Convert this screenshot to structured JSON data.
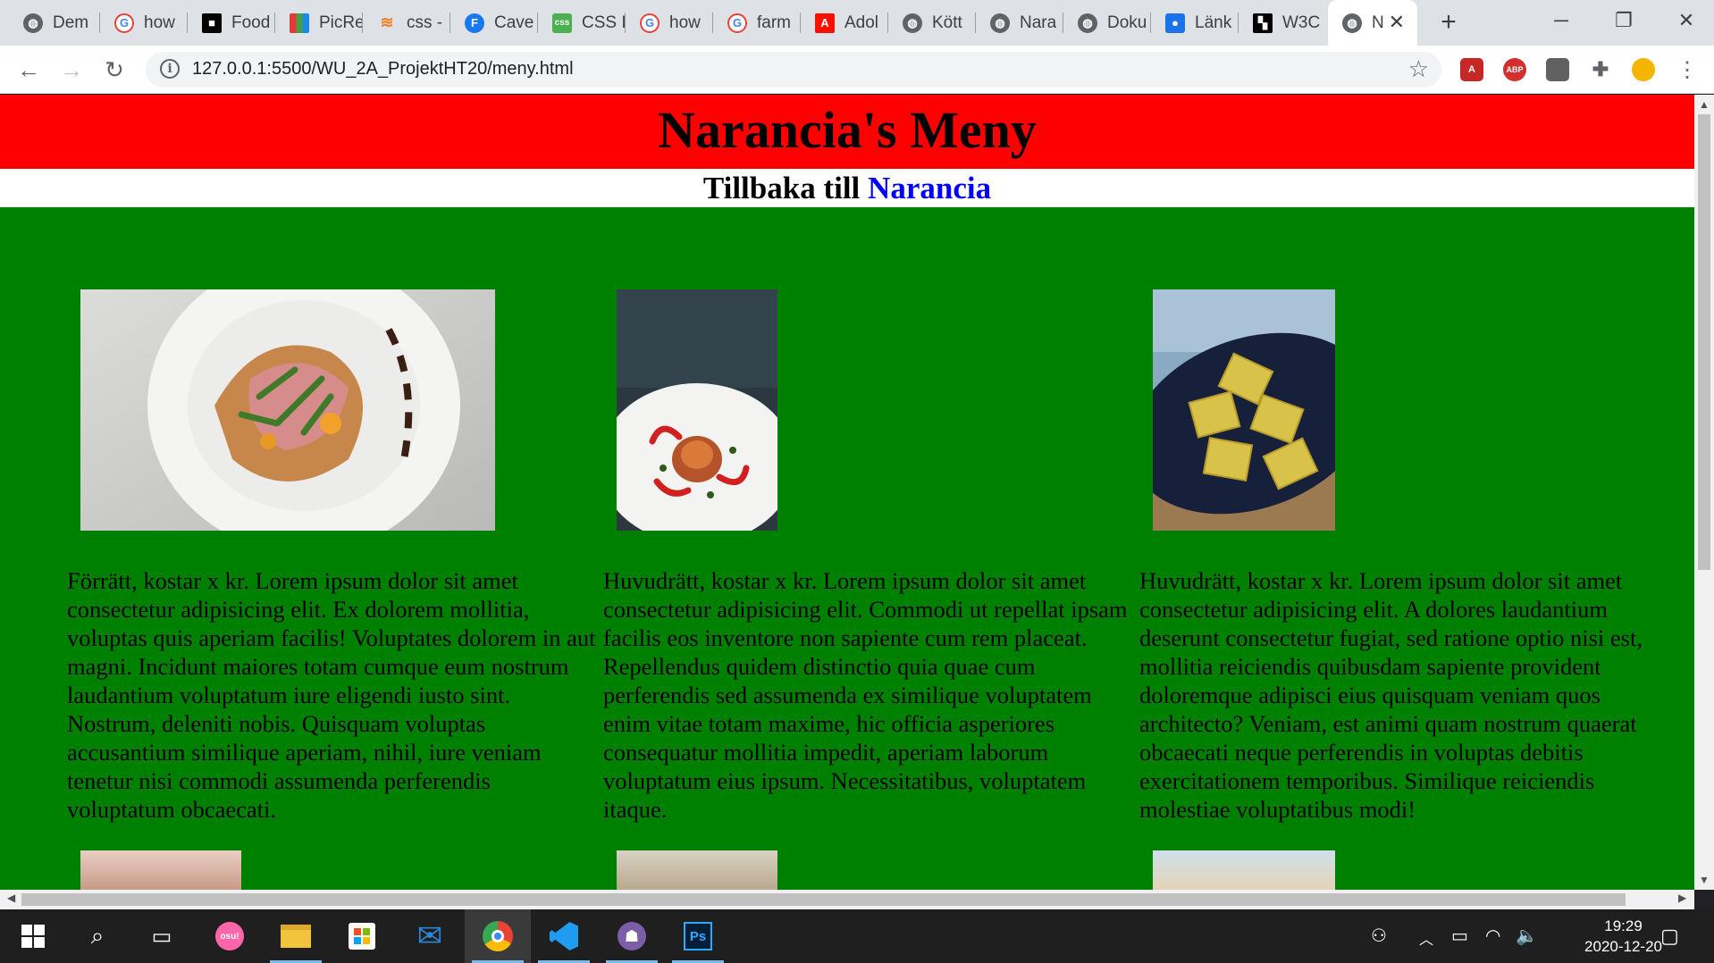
{
  "browser": {
    "tabs": [
      {
        "title": "Dem",
        "icon": "globe-icon"
      },
      {
        "title": "how",
        "icon": "google-icon"
      },
      {
        "title": "Food",
        "icon": "unsplash-icon"
      },
      {
        "title": "PicRe",
        "icon": "picresize-icon"
      },
      {
        "title": "css -",
        "icon": "stackoverflow-icon"
      },
      {
        "title": "Cave",
        "icon": "facebook-icon"
      },
      {
        "title": "CSS I",
        "icon": "css-icon"
      },
      {
        "title": "how",
        "icon": "google-icon"
      },
      {
        "title": "farm",
        "icon": "google-icon"
      },
      {
        "title": "Adol",
        "icon": "adobe-icon"
      },
      {
        "title": "Kött",
        "icon": "globe-icon"
      },
      {
        "title": "Nara",
        "icon": "globe-icon"
      },
      {
        "title": "Doku",
        "icon": "globe-icon"
      },
      {
        "title": "Länk",
        "icon": "contact-icon"
      },
      {
        "title": "W3C",
        "icon": "w3c-icon"
      },
      {
        "title": "N",
        "icon": "globe-icon",
        "active": true
      }
    ],
    "new_tab": "+",
    "url": "127.0.0.1:5500/WU_2A_ProjektHT20/meny.html",
    "extensions": [
      "pdf-extension-icon",
      "adblock-extension-icon",
      "generic-extension-icon",
      "puzzle-extensions-icon",
      "duck-extension-icon"
    ]
  },
  "page": {
    "title": "Narancia's Meny",
    "back_prefix": "Tillbaka till",
    "back_link": "Narancia",
    "colors": {
      "header": "#ff0000",
      "background": "#008000",
      "link": "#0000ff"
    },
    "items": [
      {
        "text": "Förrätt, kostar x kr. Lorem ipsum dolor sit amet consectetur adipisicing elit. Ex dolorem mollitia, voluptas quis aperiam facilis! Voluptates dolorem in aut magni. Incidunt maiores totam cumque eum nostrum laudantium voluptatum iure eligendi iusto sint. Nostrum, deleniti nobis. Quisquam voluptas accusantium similique aperiam, nihil, iure veniam tenetur nisi commodi assumenda perferendis voluptatum obcaecati."
      },
      {
        "text": "Huvudrätt, kostar x kr. Lorem ipsum dolor sit amet consectetur adipisicing elit. Commodi ut repellat ipsam facilis eos inventore non sapiente cum rem placeat. Repellendus quidem distinctio quia quae cum perferendis sed assumenda ex similique voluptatem enim vitae totam maxime, hic officia asperiores consequatur mollitia impedit, aperiam laborum voluptatum eius ipsum. Necessitatibus, voluptatem itaque."
      },
      {
        "text": "Huvudrätt, kostar x kr. Lorem ipsum dolor sit amet consectetur adipisicing elit. A dolores laudantium deserunt consectetur fugiat, sed ratione optio nisi est, mollitia reiciendis quibusdam sapiente provident doloremque adipisci eius quisquam veniam quos architecto? Veniam, est animi quam nostrum quaerat obcaecati neque perferendis in voluptas debitis exercitationem temporibus. Similique reiciendis molestiae voluptatibus modi!"
      }
    ]
  },
  "taskbar": {
    "apps": [
      "windows-start-icon",
      "search-icon",
      "task-view-icon",
      "osu-icon",
      "file-explorer-icon",
      "store-icon",
      "mail-icon",
      "chrome-icon",
      "vscode-icon",
      "github-desktop-icon",
      "photoshop-icon"
    ],
    "time": "19:29",
    "date": "2020-12-20"
  }
}
